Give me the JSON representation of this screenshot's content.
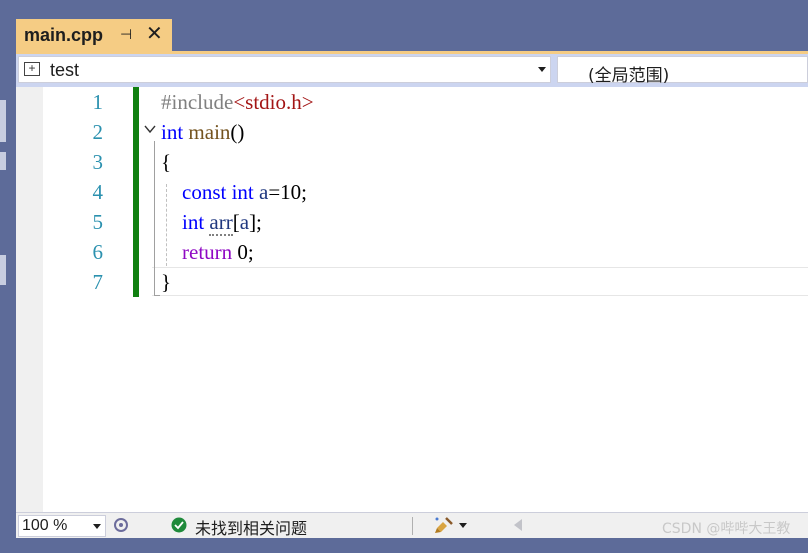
{
  "tab": {
    "title": "main.cpp",
    "pin_glyph": "⊣",
    "close_glyph": "✕"
  },
  "navbar": {
    "left_combo": "test",
    "right_combo": "(全局范围)"
  },
  "editor": {
    "line_numbers": [
      "1",
      "2",
      "3",
      "4",
      "5",
      "6",
      "7"
    ],
    "lines": [
      [
        {
          "t": "#include",
          "c": "pp"
        },
        {
          "t": "<stdio.h>",
          "c": "str"
        }
      ],
      [
        {
          "t": "int",
          "c": "kw-blue"
        },
        {
          "t": " ",
          "c": ""
        },
        {
          "t": "main",
          "c": "fn"
        },
        {
          "t": "()",
          "c": ""
        }
      ],
      [
        {
          "t": "{",
          "c": ""
        }
      ],
      [
        {
          "t": "    ",
          "c": ""
        },
        {
          "t": "const",
          "c": "kw-blue"
        },
        {
          "t": " ",
          "c": ""
        },
        {
          "t": "int",
          "c": "kw-blue"
        },
        {
          "t": " ",
          "c": ""
        },
        {
          "t": "a",
          "c": "var"
        },
        {
          "t": "=10;",
          "c": ""
        }
      ],
      [
        {
          "t": "    ",
          "c": ""
        },
        {
          "t": "int",
          "c": "kw-blue"
        },
        {
          "t": " ",
          "c": ""
        },
        {
          "t": "arr",
          "c": "var squiggle"
        },
        {
          "t": "[",
          "c": ""
        },
        {
          "t": "a",
          "c": "var"
        },
        {
          "t": "];",
          "c": ""
        }
      ],
      [
        {
          "t": "    ",
          "c": ""
        },
        {
          "t": "return",
          "c": "kw-purple"
        },
        {
          "t": " 0;",
          "c": ""
        }
      ],
      [
        {
          "t": "}",
          "c": ""
        }
      ]
    ]
  },
  "statusbar": {
    "zoom": "100 %",
    "issues_text": "未找到相关问题",
    "watermark": "CSDN @哔哔大王教"
  },
  "colors": {
    "active_tab": "#f5cc84",
    "frame": "#5d6b99",
    "change_bar": "#108010",
    "line_number": "#2b91af"
  }
}
